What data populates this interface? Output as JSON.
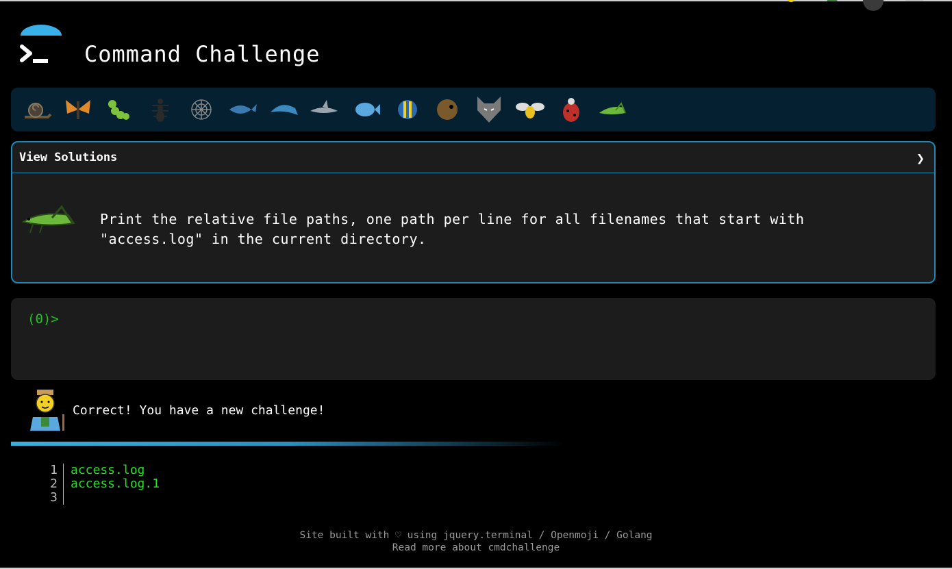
{
  "header": {
    "title": "Command Challenge"
  },
  "animals": [
    "snail-icon",
    "butterfly-icon",
    "caterpillar-icon",
    "ant-icon",
    "spider-web-icon",
    "whale-icon",
    "dolphin-icon",
    "shark-icon",
    "fish-icon",
    "tropical-fish-icon",
    "blowfish-icon",
    "wolf-icon",
    "bee-icon",
    "ladybug-icon",
    "grasshopper-icon"
  ],
  "panel": {
    "solutions_label": "View Solutions",
    "chevron": "❯",
    "challenge_text": "Print the relative file paths, one path per line for all filenames that start with \"access.log\" in the current directory."
  },
  "terminal": {
    "prompt": "(0)>"
  },
  "result": {
    "message": "Correct! You have a new challenge!"
  },
  "editor": {
    "lines": [
      {
        "num": "1",
        "text": "access.log"
      },
      {
        "num": "2",
        "text": "access.log.1"
      },
      {
        "num": "3",
        "text": ""
      }
    ]
  },
  "footer": {
    "line1": "Site built with ♡ using jquery.terminal / Openmoji / Golang",
    "line2": "Read more about cmdchallenge"
  },
  "colors": {
    "accent": "#1e88b8",
    "prompt": "#22c422",
    "output": "#22e022"
  }
}
